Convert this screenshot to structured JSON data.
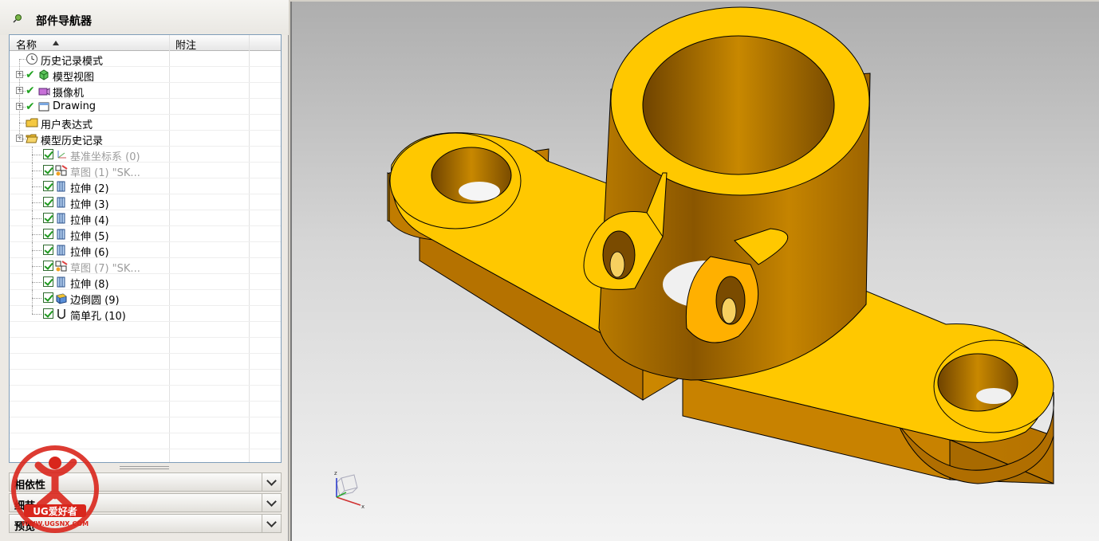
{
  "navigator": {
    "title": "部件导航器",
    "columns": {
      "name": "名称",
      "note": "附注"
    },
    "items": [
      {
        "label": "历史记录模式",
        "icon": "clock-icon",
        "expander": "",
        "dim": false
      },
      {
        "label": "模型视图",
        "icon": "model-views-icon",
        "expander": "+",
        "dim": false
      },
      {
        "label": "摄像机",
        "icon": "camera-icon",
        "expander": "+",
        "dim": false
      },
      {
        "label": "Drawing",
        "icon": "drawing-icon",
        "expander": "+",
        "dim": false
      },
      {
        "label": "用户表达式",
        "icon": "folder-icon",
        "expander": "",
        "dim": false
      },
      {
        "label": "模型历史记录",
        "icon": "folder-open-icon",
        "expander": "−",
        "dim": false
      },
      {
        "label": "基准坐标系 (0)",
        "icon": "datum-csys-icon",
        "dim": true
      },
      {
        "label": "草图 (1) \"SK...",
        "icon": "sketch-icon",
        "dim": true
      },
      {
        "label": "拉伸 (2)",
        "icon": "extrude-icon",
        "dim": false
      },
      {
        "label": "拉伸 (3)",
        "icon": "extrude-icon",
        "dim": false
      },
      {
        "label": "拉伸 (4)",
        "icon": "extrude-icon",
        "dim": false
      },
      {
        "label": "拉伸 (5)",
        "icon": "extrude-icon",
        "dim": false
      },
      {
        "label": "拉伸 (6)",
        "icon": "extrude-icon",
        "dim": false
      },
      {
        "label": "草图 (7) \"SK...",
        "icon": "sketch-icon",
        "dim": true
      },
      {
        "label": "拉伸 (8)",
        "icon": "extrude-icon",
        "dim": false
      },
      {
        "label": "边倒圆 (9)",
        "icon": "edge-blend-icon",
        "dim": false
      },
      {
        "label": "简单孔 (10)",
        "icon": "hole-icon",
        "dim": false
      }
    ]
  },
  "panels": [
    {
      "label": "相依性"
    },
    {
      "label": "细节"
    },
    {
      "label": "预览"
    }
  ],
  "watermark": {
    "brand": "UG爱好者",
    "url": "WWW.UGSNX.COM"
  },
  "viewport": {
    "triad": {
      "x": "x",
      "z": "z"
    },
    "colors": {
      "face": "#ffc800",
      "side": "#c98400",
      "shadow": "#8a5500",
      "edge": "#000000"
    }
  }
}
